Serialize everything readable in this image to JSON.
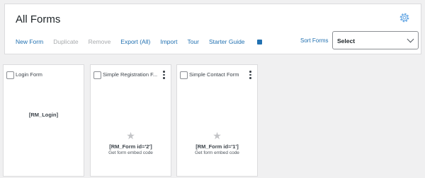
{
  "header": {
    "title": "All Forms",
    "settings_icon": "gear-icon"
  },
  "toolbar": {
    "new_form": "New Form",
    "duplicate": "Duplicate",
    "remove": "Remove",
    "export": "Export (All)",
    "import": "Import",
    "tour": "Tour",
    "starter_guide": "Starter Guide",
    "sort_label": "Sort Forms",
    "sort_selected": "Select"
  },
  "cards": [
    {
      "title": "Login Form",
      "shortcode": "[RM_Login]"
    },
    {
      "title": "Simple Registration F...",
      "shortcode": "[RM_Form id='2']",
      "embed": "Get form embed code"
    },
    {
      "title": "Simple Contact Form",
      "shortcode": "[RM_Form id='1']",
      "embed": "Get form embed code"
    }
  ],
  "colors": {
    "link": "#2271b1",
    "disabled": "#a7aaad",
    "background": "#f0f0f1"
  }
}
